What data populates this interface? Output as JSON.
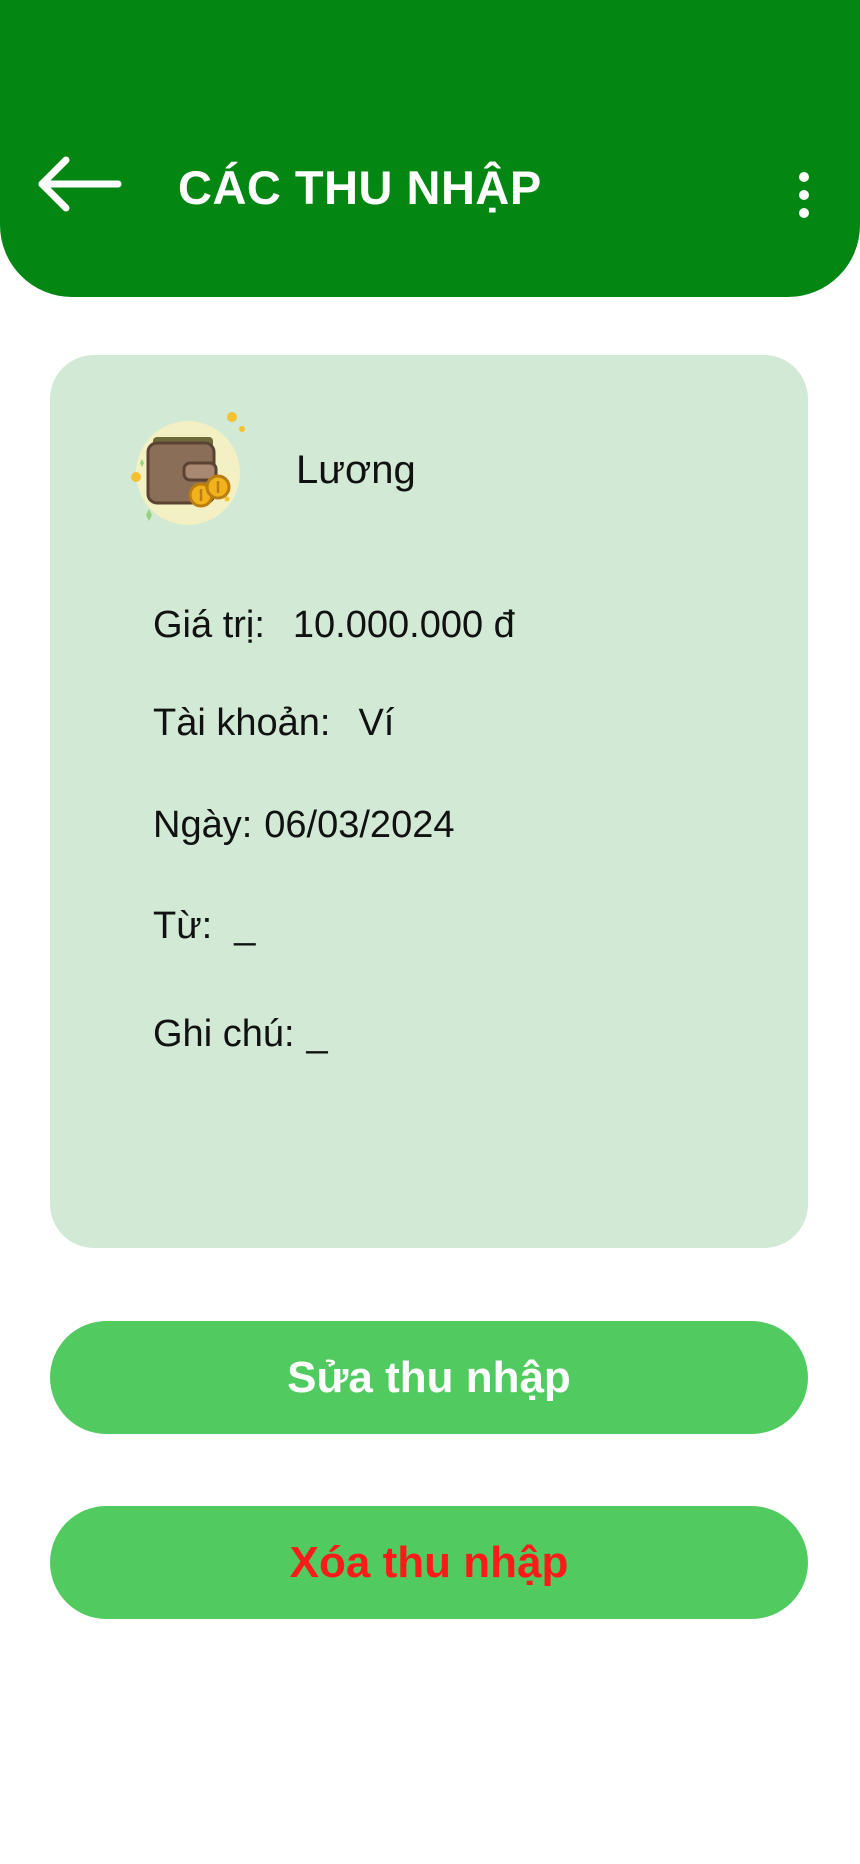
{
  "header": {
    "title": "CÁC THU NHẬP",
    "back_icon": "arrow-left-icon",
    "menu_icon": "more-vertical-icon",
    "background_color": "#038612"
  },
  "entry": {
    "category_icon": "wallet-coins-icon",
    "category_name": "Lương",
    "fields": {
      "value": {
        "label": "Giá trị:",
        "value": "10.000.000 đ"
      },
      "account": {
        "label": "Tài khoản:",
        "value": "Ví"
      },
      "date": {
        "label": "Ngày:",
        "value": "06/03/2024"
      },
      "from": {
        "label": "Từ:",
        "value": "_"
      },
      "note": {
        "label": "Ghi chú:",
        "value": "_"
      }
    },
    "card_color": "#d1e9d5"
  },
  "actions": {
    "edit_label": "Sửa thu nhập",
    "delete_label": "Xóa thu nhập",
    "button_color": "#51cb60",
    "delete_text_color": "#ff1a1a"
  }
}
